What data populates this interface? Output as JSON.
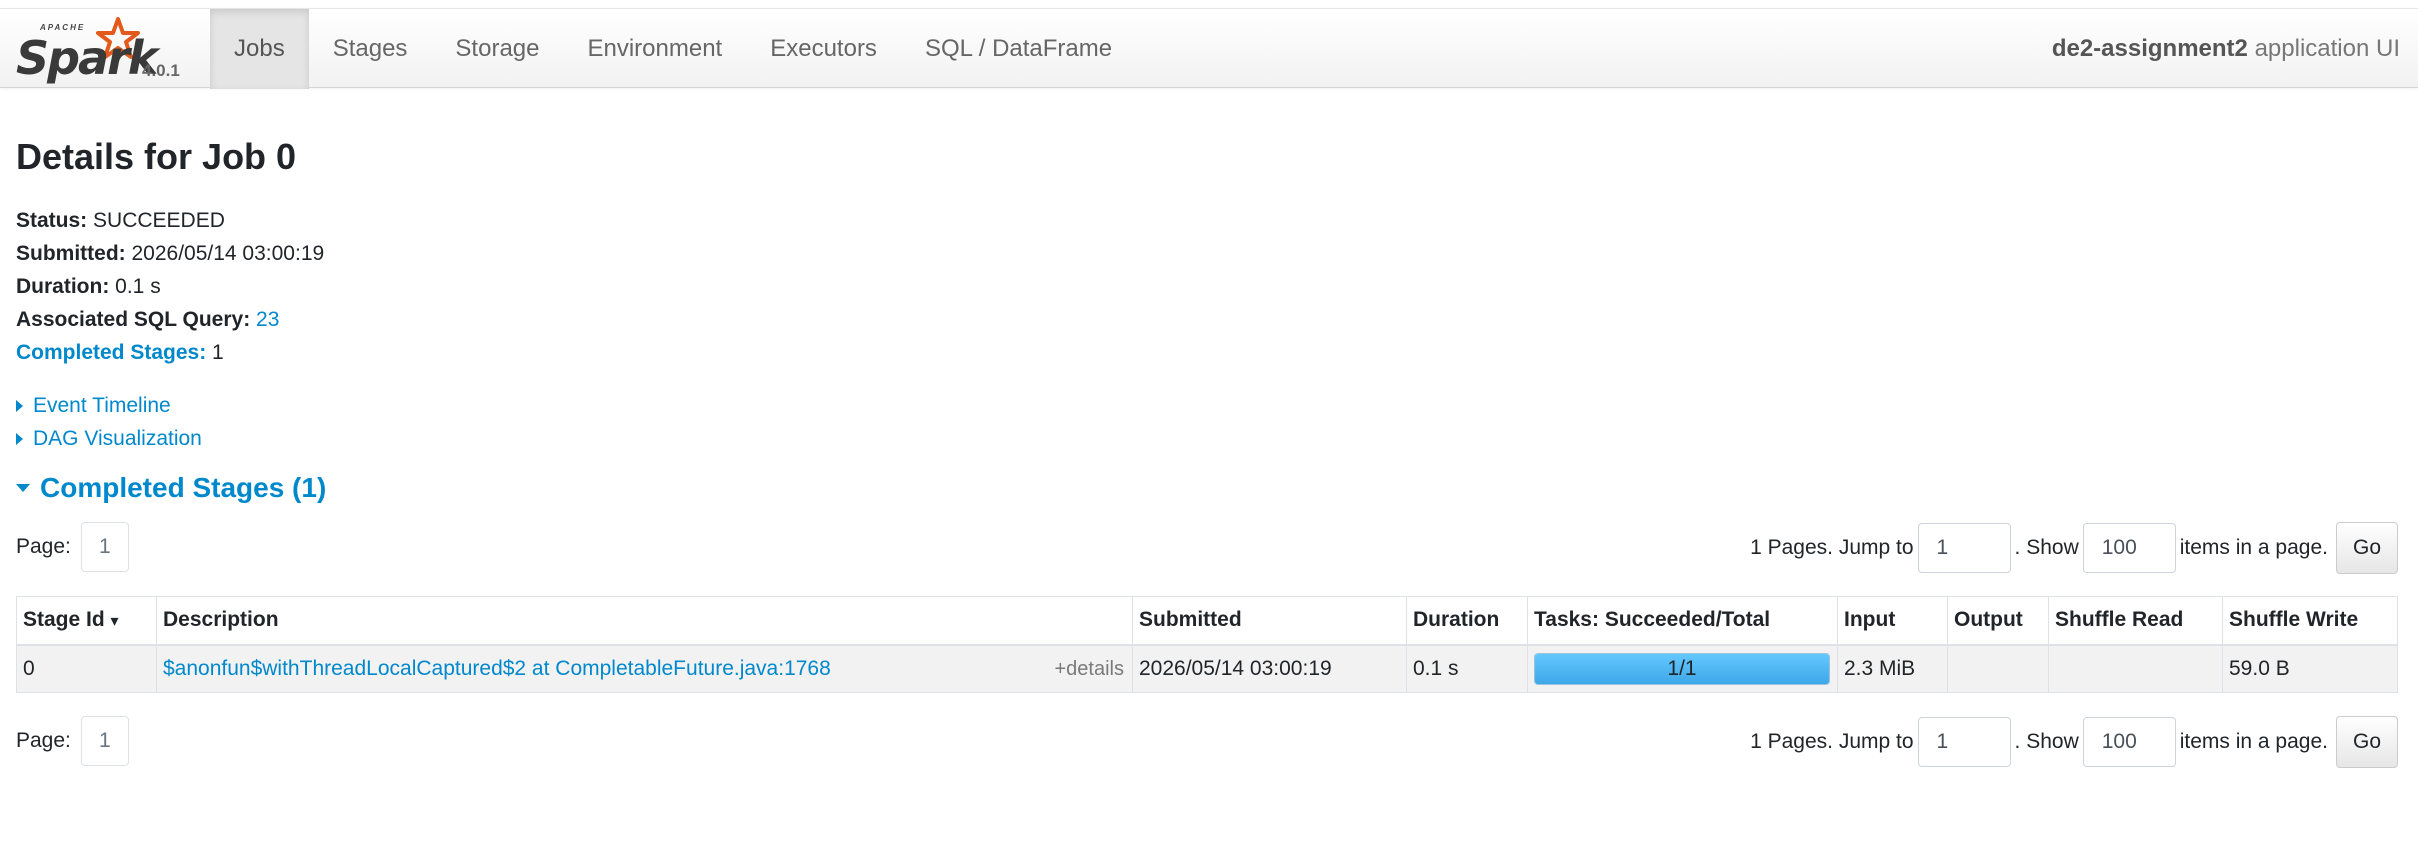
{
  "brand": {
    "apache": "APACHE",
    "name": "Spark",
    "version": "4.0.1"
  },
  "nav": {
    "tabs": [
      {
        "label": "Jobs",
        "active": true
      },
      {
        "label": "Stages"
      },
      {
        "label": "Storage"
      },
      {
        "label": "Environment"
      },
      {
        "label": "Executors"
      },
      {
        "label": "SQL / DataFrame"
      }
    ],
    "app_name": "de2-assignment2",
    "app_suffix": " application UI"
  },
  "page_title": "Details for Job 0",
  "summary": {
    "status_label": "Status:",
    "status": "SUCCEEDED",
    "submitted_label": "Submitted:",
    "submitted": "2026/05/14 03:00:19",
    "duration_label": "Duration:",
    "duration": "0.1 s",
    "sql_label": "Associated SQL Query:",
    "sql_query": "23",
    "completed_label": "Completed Stages:",
    "completed": "1"
  },
  "toggles": {
    "timeline": "Event Timeline",
    "dag": "DAG Visualization"
  },
  "section_title": "Completed Stages (1)",
  "paging": {
    "page_label": "Page:",
    "current_page": "1",
    "pages_text": "1 Pages. Jump to",
    "jump_value": "1",
    "show_text": ". Show",
    "show_value": "100",
    "items_text": "items in a page.",
    "go_label": "Go"
  },
  "table": {
    "columns": [
      "Stage Id",
      "Description",
      "Submitted",
      "Duration",
      "Tasks: Succeeded/Total",
      "Input",
      "Output",
      "Shuffle Read",
      "Shuffle Write"
    ],
    "sort_indicator": "▾",
    "rows": [
      {
        "stage_id": "0",
        "description": "$anonfun$withThreadLocalCaptured$2 at CompletableFuture.java:1768",
        "details": "+details",
        "submitted": "2026/05/14 03:00:19",
        "duration": "0.1 s",
        "tasks": "1/1",
        "tasks_fraction": 1.0,
        "input": "2.3 MiB",
        "output": "",
        "shuffle_read": "",
        "shuffle_write": "59.0 B"
      }
    ]
  },
  "colors": {
    "link": "#0088cc",
    "progress": "#3ea7e8",
    "star": "#e25a1c"
  }
}
